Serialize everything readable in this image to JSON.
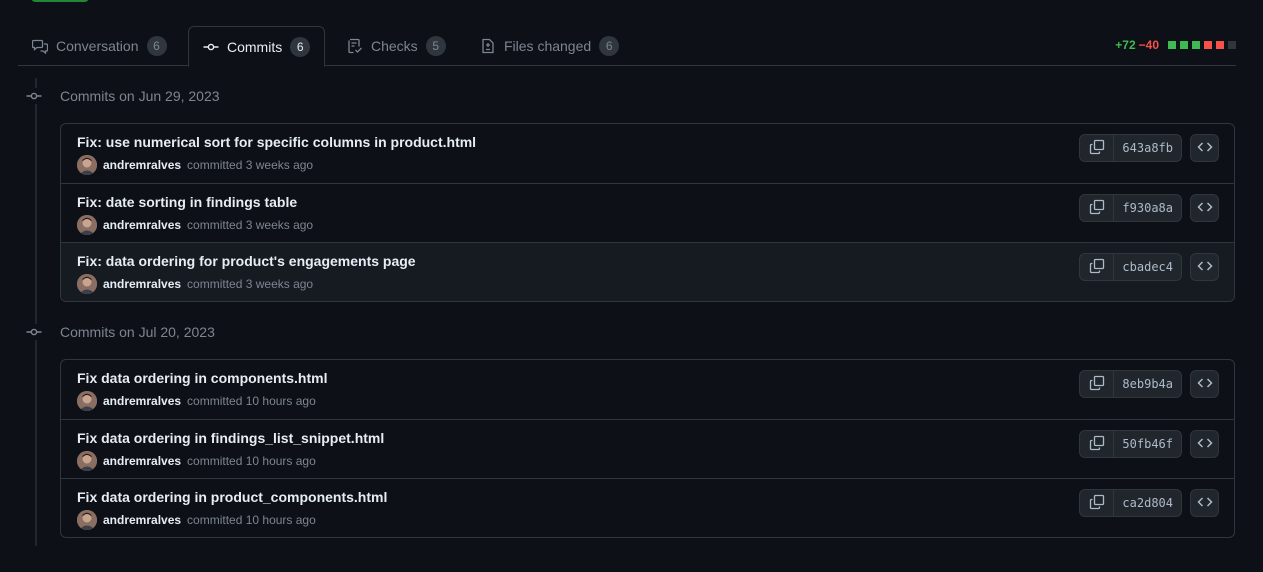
{
  "tabs": [
    {
      "label": "Conversation",
      "count": "6"
    },
    {
      "label": "Commits",
      "count": "6"
    },
    {
      "label": "Checks",
      "count": "5"
    },
    {
      "label": "Files changed",
      "count": "6"
    }
  ],
  "diffstat": {
    "additions": "+72",
    "deletions": "−40",
    "colors": {
      "add": "#3fb950",
      "del": "#f85149",
      "neutral": "#30363d"
    }
  },
  "groups": [
    {
      "header": "Commits on Jun 29, 2023",
      "commits": [
        {
          "title": "Fix: use numerical sort for specific columns in product.html",
          "author": "andremralves",
          "meta": "committed 3 weeks ago",
          "sha": "643a8fb"
        },
        {
          "title": "Fix: date sorting in findings table",
          "author": "andremralves",
          "meta": "committed 3 weeks ago",
          "sha": "f930a8a"
        },
        {
          "title": "Fix: data ordering for product's engagements page",
          "author": "andremralves",
          "meta": "committed 3 weeks ago",
          "sha": "cbadec4"
        }
      ]
    },
    {
      "header": "Commits on Jul 20, 2023",
      "commits": [
        {
          "title": "Fix data ordering in components.html",
          "author": "andremralves",
          "meta": "committed 10 hours ago",
          "sha": "8eb9b4a"
        },
        {
          "title": "Fix data ordering in findings_list_snippet.html",
          "author": "andremralves",
          "meta": "committed 10 hours ago",
          "sha": "50fb46f"
        },
        {
          "title": "Fix data ordering in product_components.html",
          "author": "andremralves",
          "meta": "committed 10 hours ago",
          "sha": "ca2d804"
        }
      ]
    }
  ],
  "colors": {
    "background": "#0d1117",
    "border": "#30363d",
    "muted": "#7d8590",
    "accent_green": "#238636"
  }
}
